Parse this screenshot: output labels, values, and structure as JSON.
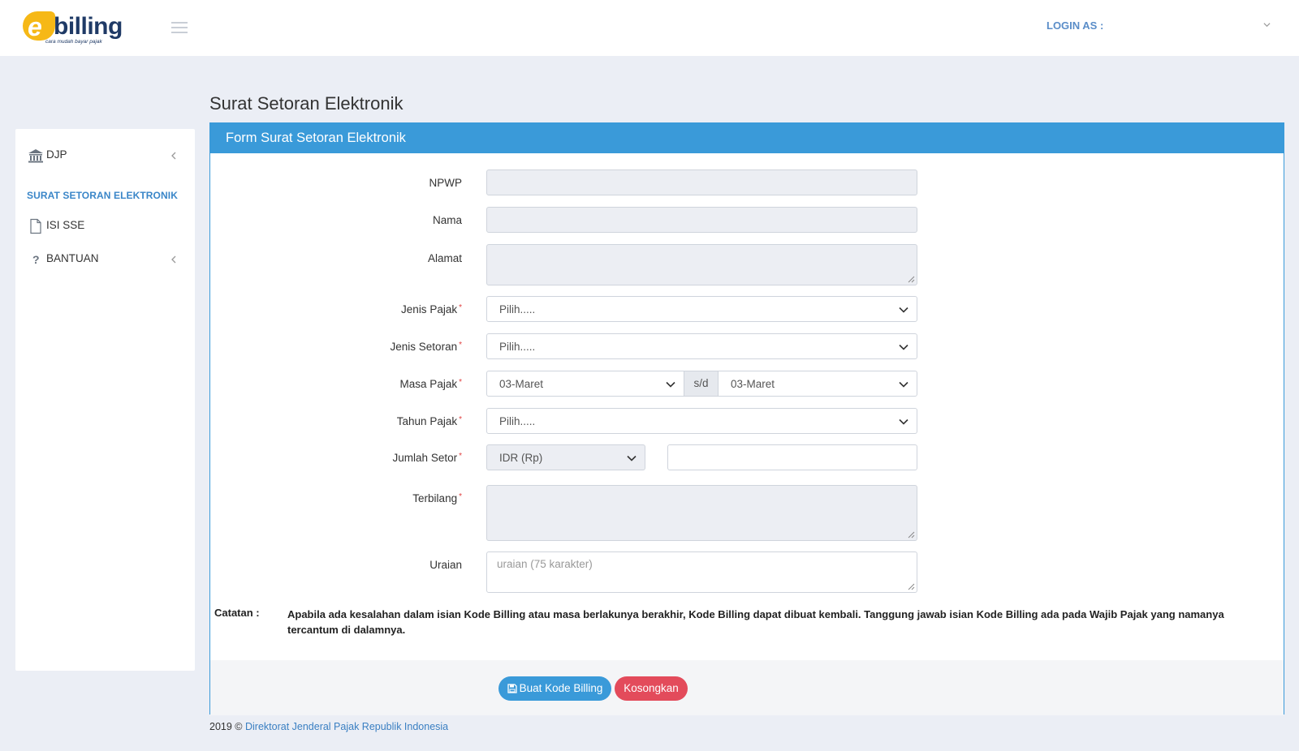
{
  "header": {
    "logo_letter": "e",
    "logo_word": "billing",
    "logo_tagline": "cara mudah bayar pajak",
    "login_label": "LOGIN AS :",
    "icons": [
      "menu-icon",
      "chevron-down-icon"
    ]
  },
  "sidebar": {
    "djp_label": "DJP",
    "section_title": "SURAT SETORAN ELEKTRONIK",
    "isi_sse_label": "ISI SSE",
    "bantuan_label": "BANTUAN",
    "icons": [
      "bank-icon",
      "file-icon",
      "question-icon",
      "chevron-left-icon"
    ]
  },
  "page": {
    "title": "Surat Setoran Elektronik"
  },
  "form": {
    "panel_title": "Form Surat Setoran Elektronik",
    "npwp_label": "NPWP",
    "nama_label": "Nama",
    "alamat_label": "Alamat",
    "jenis_pajak_label": "Jenis Pajak",
    "jenis_pajak_value": "Pilih.....",
    "jenis_setoran_label": "Jenis Setoran",
    "jenis_setoran_value": "Pilih.....",
    "masa_pajak_label": "Masa Pajak",
    "masa_pajak_from": "03-Maret",
    "masa_pajak_sep": "s/d",
    "masa_pajak_to": "03-Maret",
    "tahun_pajak_label": "Tahun Pajak",
    "tahun_pajak_value": "Pilih.....",
    "jumlah_setor_label": "Jumlah Setor",
    "currency_value": "IDR (Rp)",
    "terbilang_label": "Terbilang",
    "uraian_label": "Uraian",
    "uraian_placeholder": "uraian (75 karakter)",
    "required_mark": "*"
  },
  "note": {
    "label": "Catatan :",
    "text": "Apabila ada kesalahan dalam isian Kode Billing atau masa berlakunya berakhir, Kode Billing dapat dibuat kembali. Tanggung jawab isian Kode Billing ada pada Wajib Pajak yang namanya tercantum di dalamnya."
  },
  "buttons": {
    "create_label": "Buat Kode Billing",
    "clear_label": "Kosongkan"
  },
  "footer": {
    "year": "2019 ©",
    "org": "Direktorat Jenderal Pajak Republik Indonesia"
  },
  "colors": {
    "accent": "#3a9ad9",
    "danger": "#e34b5b",
    "background": "#ebeef5",
    "logo_yellow": "#f6b816",
    "logo_navy": "#1f3a66"
  }
}
